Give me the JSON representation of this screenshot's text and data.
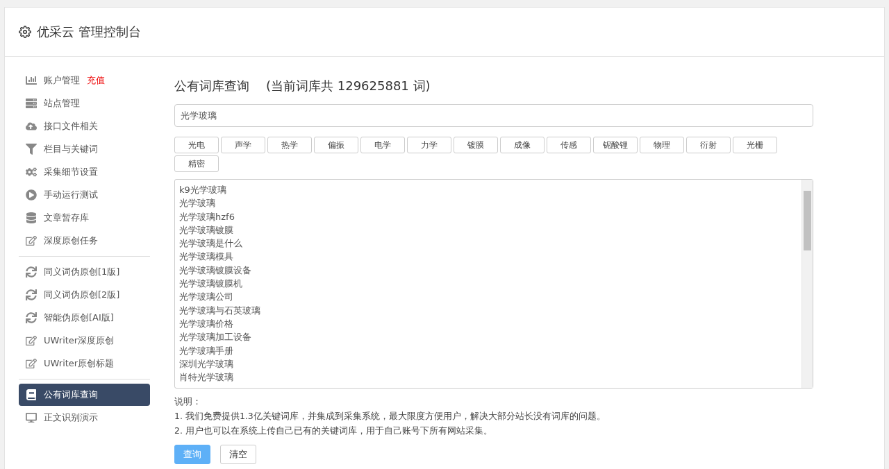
{
  "header": {
    "title": "优采云 管理控制台"
  },
  "sidebar": {
    "groups": [
      [
        {
          "label": "账户管理",
          "badge": "充值",
          "selected": false
        },
        {
          "label": "站点管理",
          "selected": false
        },
        {
          "label": "接口文件相关",
          "selected": false
        },
        {
          "label": "栏目与关键词",
          "selected": false
        },
        {
          "label": "采集细节设置",
          "selected": false
        },
        {
          "label": "手动运行测试",
          "selected": false
        },
        {
          "label": "文章暂存库",
          "selected": false
        },
        {
          "label": "深度原创任务",
          "selected": false
        }
      ],
      [
        {
          "label": "同义词伪原创[1版]",
          "selected": false
        },
        {
          "label": "同义词伪原创[2版]",
          "selected": false
        },
        {
          "label": "智能伪原创[AI版]",
          "selected": false
        },
        {
          "label": "UWriter深度原创",
          "selected": false
        },
        {
          "label": "UWriter原创标题",
          "selected": false
        }
      ],
      [
        {
          "label": "公有词库查询",
          "selected": true
        },
        {
          "label": "正文识别演示",
          "selected": false
        }
      ]
    ]
  },
  "main": {
    "title": "公有词库查询",
    "count_text": "(当前词库共 129625881 词)",
    "search": {
      "value": "光学玻璃"
    },
    "tags": [
      "光电",
      "声学",
      "热学",
      "偏振",
      "电学",
      "力学",
      "镀膜",
      "成像",
      "传感",
      "铌酸锂",
      "物理",
      "衍射",
      "光栅",
      "精密"
    ],
    "results": [
      "k9光学玻璃",
      "光学玻璃",
      "光学玻璃hzf6",
      "光学玻璃镀膜",
      "光学玻璃是什么",
      "光学玻璃模具",
      "光学玻璃镀膜设备",
      "光学玻璃镀膜机",
      "光学玻璃公司",
      "光学玻璃与石英玻璃",
      "光学玻璃价格",
      "光学玻璃加工设备",
      "光学玻璃手册",
      "深圳光学玻璃",
      "肖特光学玻璃"
    ],
    "notes_title": "说明：",
    "notes": [
      "1. 我们免费提供1.3亿关键词库，并集成到采集系统，最大限度方便用户，解决大部分站长没有词库的问题。",
      "2. 用户也可以在系统上传自己已有的关键词库，用于自己账号下所有网站采集。"
    ],
    "buttons": [
      {
        "label": "查询",
        "kind": "primary"
      },
      {
        "label": "清空",
        "kind": "default"
      }
    ]
  }
}
